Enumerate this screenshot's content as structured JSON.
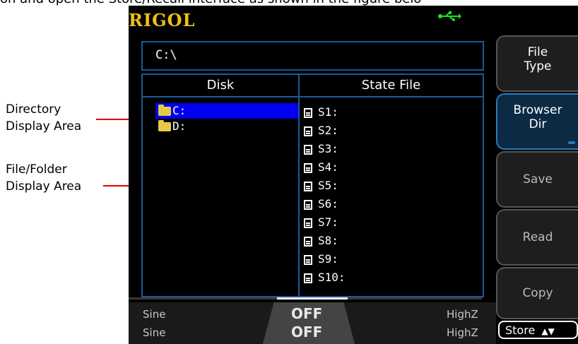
{
  "document": {
    "top_text": "on and open the Store/Recall interface as shown in the figure belo"
  },
  "callouts": {
    "directory": [
      "Directory",
      "Display Area"
    ],
    "file_folder": [
      "File/Folder",
      "Display Area"
    ]
  },
  "screen": {
    "logo": "RIGOL",
    "usb_icon": "usb-icon",
    "path": "C:\\",
    "headers": {
      "disk": "Disk",
      "state": "State File"
    },
    "directories": [
      {
        "label": "C:",
        "selected": true
      },
      {
        "label": "D:",
        "selected": false
      }
    ],
    "files": [
      "S1:",
      "S2:",
      "S3:",
      "S4:",
      "S5:",
      "S6:",
      "S7:",
      "S8:",
      "S9:",
      "S10:"
    ],
    "status": {
      "ch1_wave": "Sine",
      "ch2_wave": "Sine",
      "ch1_out": "OFF",
      "ch2_out": "OFF",
      "ch1_load": "HighZ",
      "ch2_load": "HighZ"
    },
    "softkeys": {
      "file_type": [
        "File",
        "Type"
      ],
      "browser": [
        "Browser",
        "Dir"
      ],
      "save": "Save",
      "read": "Read",
      "copy": "Copy",
      "pager": "Store"
    },
    "colors": {
      "logo": "#f0c018",
      "frame_blue": "#1a5a9a",
      "selection": "#0000ee",
      "arrow": "#e00000",
      "usb": "#20e020"
    }
  }
}
